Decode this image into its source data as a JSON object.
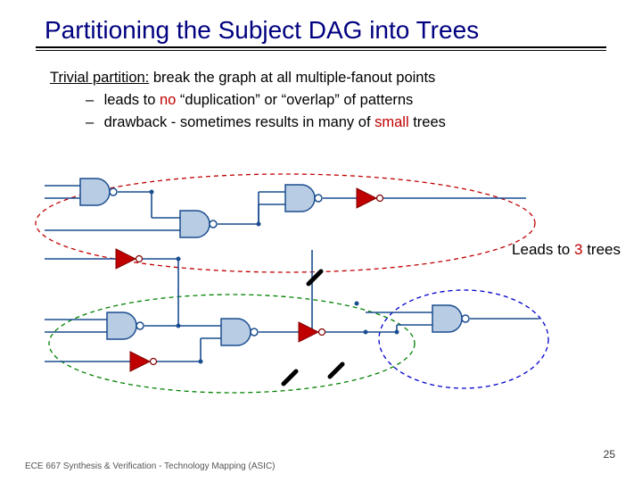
{
  "title": "Partitioning the Subject DAG into Trees",
  "line1_pre": "Trivial partition:",
  "line1_post": " break the graph at all multiple-fanout points",
  "bullet_dash": "–",
  "bullet1_a": "leads to ",
  "bullet1_no": "no",
  "bullet1_b": " “duplication” or “overlap” of patterns",
  "bullet2_a": "drawback - sometimes results in many of ",
  "bullet2_small": "small",
  "bullet2_b": " trees",
  "leads_a": "Leads to ",
  "leads_n": "3",
  "leads_b": " trees",
  "footer": "ECE 667 Synthesis & Verification - Technology Mapping (ASIC)",
  "pagenum": "25"
}
